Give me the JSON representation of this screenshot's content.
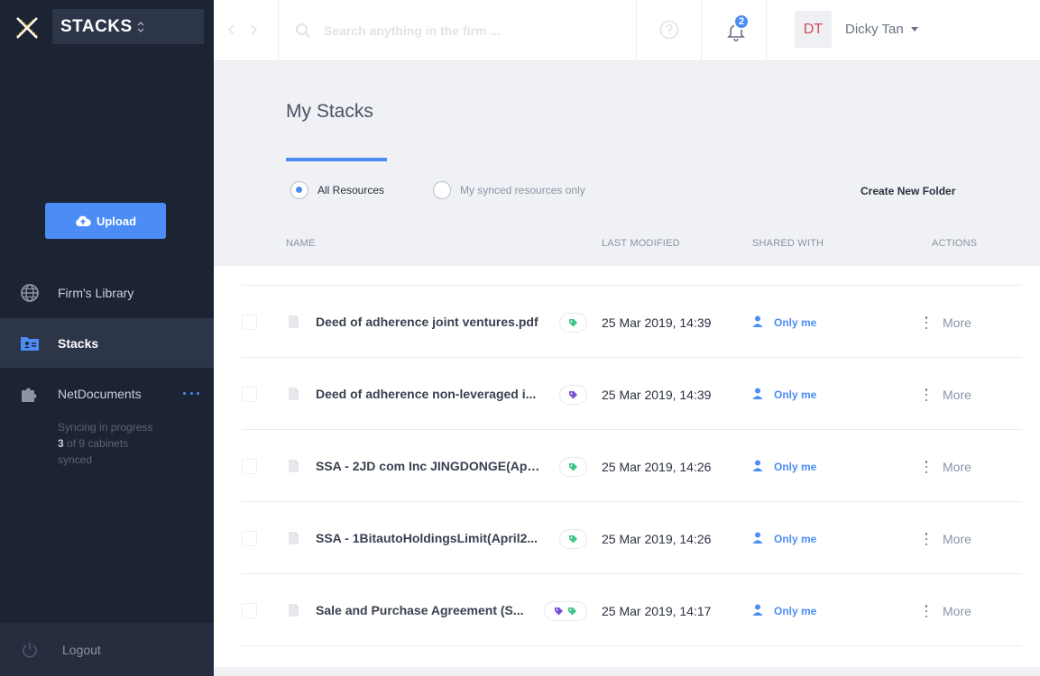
{
  "sidebar": {
    "workspace": "STACKS",
    "upload_label": "Upload",
    "items": [
      {
        "label": "Firm's Library"
      },
      {
        "label": "Stacks"
      },
      {
        "label": "NetDocuments"
      }
    ],
    "sync": {
      "status": "Syncing in progress",
      "synced_count": "3",
      "total_text": " of 9 cabinets",
      "synced_label": "synced"
    },
    "logout_label": "Logout"
  },
  "topbar": {
    "search_placeholder": "Search anything in the firm ...",
    "notification_count": "2",
    "user_initials": "DT",
    "user_name": "Dicky Tan"
  },
  "page": {
    "title": "My Stacks",
    "filters": [
      {
        "label": "All Resources",
        "selected": true
      },
      {
        "label": "My synced resources only",
        "selected": false
      }
    ],
    "create_folder": "Create New Folder",
    "columns": {
      "name": "NAME",
      "modified": "LAST MODIFIED",
      "shared": "SHARED WITH",
      "actions": "ACTIONS"
    }
  },
  "files": [
    {
      "name": "Deed of adherence joint ventures.pdf",
      "tags": [
        "green"
      ],
      "modified": "25 Mar 2019, 14:39",
      "shared": "Only me",
      "action": "More"
    },
    {
      "name": "Deed of adherence non-leveraged i...",
      "tags": [
        "purple"
      ],
      "modified": "25 Mar 2019, 14:39",
      "shared": "Only me",
      "action": "More"
    },
    {
      "name": "SSA - 2JD com Inc JINGDONGE(Apri...",
      "tags": [
        "green"
      ],
      "modified": "25 Mar 2019, 14:26",
      "shared": "Only me",
      "action": "More"
    },
    {
      "name": "SSA - 1BitautoHoldingsLimit(April2...",
      "tags": [
        "green"
      ],
      "modified": "25 Mar 2019, 14:26",
      "shared": "Only me",
      "action": "More"
    },
    {
      "name": "Sale and Purchase Agreement (S...",
      "tags": [
        "purple",
        "green"
      ],
      "modified": "25 Mar 2019, 14:17",
      "shared": "Only me",
      "action": "More"
    }
  ],
  "colors": {
    "accent": "#4b8cf5",
    "sidebar_bg": "#1c2333",
    "tag_green": "#3cc48a",
    "tag_purple": "#7b4fd6"
  }
}
